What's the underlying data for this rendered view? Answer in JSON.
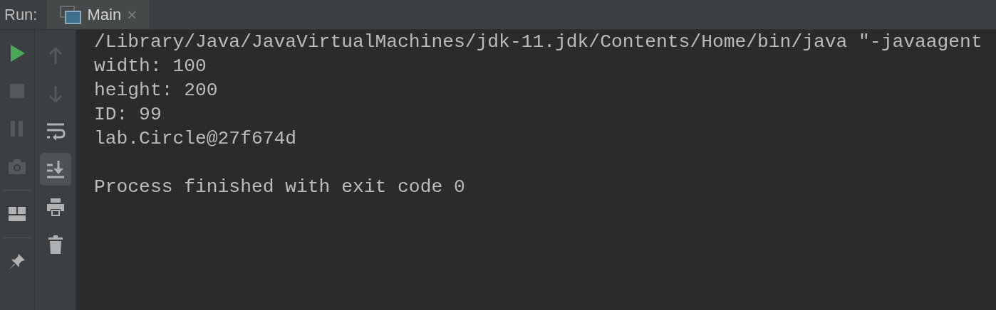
{
  "run_label": "Run:",
  "tabs": [
    {
      "label": "Main",
      "close": "×",
      "selected": true
    }
  ],
  "left_toolbar": [
    {
      "kind": "run",
      "disabled": false
    },
    {
      "kind": "stop",
      "disabled": true
    },
    {
      "kind": "pause",
      "disabled": true
    },
    {
      "kind": "camera",
      "disabled": true
    },
    {
      "kind": "separator"
    },
    {
      "kind": "layout",
      "disabled": false
    },
    {
      "kind": "separator"
    },
    {
      "kind": "pin",
      "disabled": false
    }
  ],
  "console_toolbar": [
    {
      "kind": "up",
      "disabled": true,
      "selected": false
    },
    {
      "kind": "down",
      "disabled": true,
      "selected": false
    },
    {
      "kind": "wrap",
      "disabled": false,
      "selected": false
    },
    {
      "kind": "scroll-end",
      "disabled": false,
      "selected": true
    },
    {
      "kind": "print",
      "disabled": false,
      "selected": false
    },
    {
      "kind": "trash",
      "disabled": false,
      "selected": false
    }
  ],
  "console_lines": [
    "/Library/Java/JavaVirtualMachines/jdk-11.jdk/Contents/Home/bin/java \"-javaagent",
    "width: 100",
    "height: 200",
    "ID: 99",
    "lab.Circle@27f674d"
  ],
  "exit_message": "Process finished with exit code 0"
}
